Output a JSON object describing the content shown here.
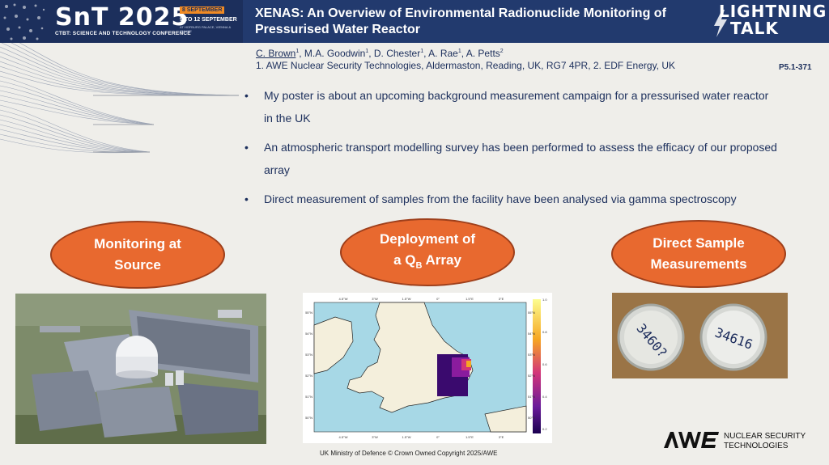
{
  "header": {
    "conference_logo": "SnT 2025",
    "conference_sub": "CTBT: SCIENCE AND TECHNOLOGY CONFERENCE",
    "date_line1": "8 SEPTEMBER",
    "date_line2": "9 TO 12 SEPTEMBER",
    "date_line3": "AT HOFBURG PALACE, VIENNA & ONLINE",
    "title": "XENAS: An Overview of Environmental Radionuclide Monitoring of Pressurised Water Reactor",
    "badge_line1": "LIGHTNING",
    "badge_line2": "TALK"
  },
  "authors": {
    "presenter": "C. Brown",
    "presenter_sup": "1",
    "rest": ", M.A. Goodwin",
    "rest_sup": "1",
    "rest2": ", D. Chester",
    "rest2_sup": "1",
    "rest3": ", A. Rae",
    "rest3_sup": "1",
    "rest4": ", A. Petts",
    "rest4_sup": "2",
    "affiliations": "1. AWE Nuclear Security Technologies, Aldermaston, Reading, UK, RG7 4PR, 2. EDF Energy, UK"
  },
  "poster_code": "P5.1-371",
  "bullets": [
    "My poster is about an upcoming background measurement campaign for a pressurised water reactor in the UK",
    "An atmospheric transport modelling survey has been performed to assess the efficacy of our proposed array",
    "Direct measurement of samples from the facility have been analysed via gamma spectroscopy"
  ],
  "bullet_glyph": "•",
  "ovals": {
    "source_line1": "Monitoring at",
    "source_line2": "Source",
    "array_line1": "Deployment of",
    "array_line2a": "a Q",
    "array_line2_sub": "B",
    "array_line2b": " Array",
    "samples_line1": "Direct Sample",
    "samples_line2": "Measurements"
  },
  "map": {
    "lon_ticks": [
      "4.5°W",
      "3°W",
      "1.5°W",
      "0°",
      "1.5°E",
      "3°E"
    ],
    "lat_ticks": [
      "55°N",
      "54°N",
      "53°N",
      "52°N",
      "51°N",
      "50°N"
    ],
    "colorbar_ticks": [
      "1.0",
      "0.8",
      "0.6",
      "0.4",
      "0.2"
    ]
  },
  "samples": {
    "label_left": "3460?",
    "label_right": "34616"
  },
  "footer": "UK Ministry of Defence © Crown Owned Copyright 2025/AWE",
  "awe": {
    "line1": "NUCLEAR SECURITY",
    "line2": "TECHNOLOGIES"
  },
  "colors": {
    "navy": "#1c2f5c",
    "header_blue": "#223a6e",
    "oval_orange": "#e8692f",
    "accent_orange": "#f08a24",
    "sea": "#a7d8e6",
    "land": "#f4efdc"
  }
}
